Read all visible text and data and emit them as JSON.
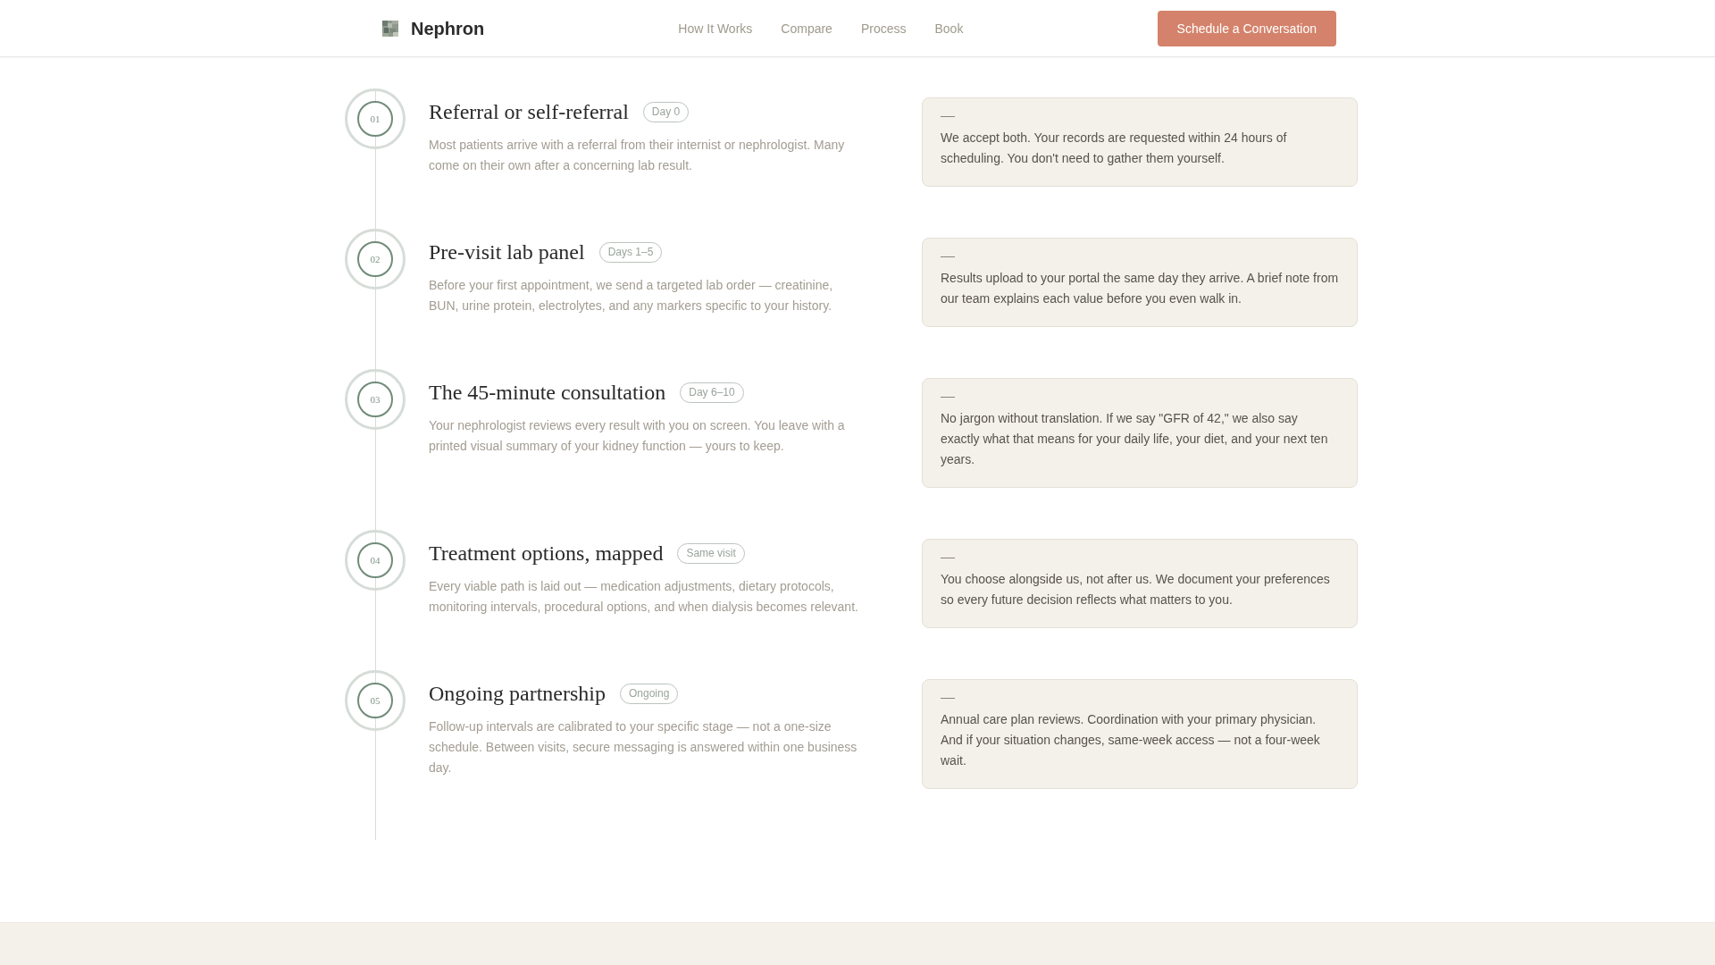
{
  "header": {
    "brand": "Nephron",
    "nav": [
      "How It Works",
      "Compare",
      "Process",
      "Book"
    ],
    "button": "Schedule a Conversation"
  },
  "steps": [
    {
      "number": "01",
      "title": "Referral or self-referral",
      "timing": "Day 0",
      "description": "Most patients arrive with a referral from their internist or nephrologist. Many come on their own after a concerning lab result.",
      "note": "We accept both. Your records are requested within 24 hours of scheduling. You don't need to gather them yourself."
    },
    {
      "number": "02",
      "title": "Pre-visit lab panel",
      "timing": "Days 1–5",
      "description": "Before your first appointment, we send a targeted lab order — creatinine, BUN, urine protein, electrolytes, and any markers specific to your history.",
      "note": "Results upload to your portal the same day they arrive. A brief note from our team explains each value before you even walk in."
    },
    {
      "number": "03",
      "title": "The 45-minute consultation",
      "timing": "Day 6–10",
      "description": "Your nephrologist reviews every result with you on screen. You leave with a printed visual summary of your kidney function — yours to keep.",
      "note": "No jargon without translation. If we say \"GFR of 42,\" we also say exactly what that means for your daily life, your diet, and your next ten years."
    },
    {
      "number": "04",
      "title": "Treatment options, mapped",
      "timing": "Same visit",
      "description": "Every viable path is laid out — medication adjustments, dietary protocols, monitoring intervals, procedural options, and when dialysis becomes relevant.",
      "note": "You choose alongside us, not after us. We document your preferences so every future decision reflects what matters to you."
    },
    {
      "number": "05",
      "title": "Ongoing partnership",
      "timing": "Ongoing",
      "description": "Follow-up intervals are calibrated to your specific stage — not a one-size schedule. Between visits, secure messaging is answered within one business day.",
      "note": "Annual care plan reviews. Coordination with your primary physician. And if your situation changes, same-week access — not a four-week wait."
    }
  ]
}
